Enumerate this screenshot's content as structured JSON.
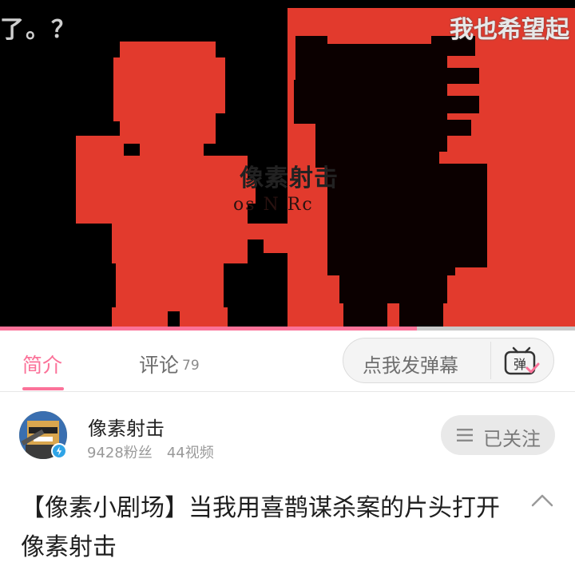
{
  "video": {
    "caption_left": "了。？",
    "caption_right": "我也希望起",
    "title_cn": "像素射击",
    "title_en": "os N Rc",
    "progress": 0.725,
    "colors": {
      "red": "#e23a2d",
      "black": "#000000"
    }
  },
  "tabs": {
    "intro": "简介",
    "comments": "评论",
    "comments_count": "79",
    "accent": "#fb7299"
  },
  "danmaku": {
    "placeholder": "点我发弹幕",
    "button_icon": "danmaku-tv-icon",
    "button_text": "弹"
  },
  "uploader": {
    "name": "像素射击",
    "fans": "9428粉丝",
    "videos": "44视频",
    "follow_label": "已关注",
    "follow_icon": "menu-icon"
  },
  "video_info": {
    "title": "【像素小剧场】当我用喜鹊谋杀案的片头打开像素射击",
    "expand_icon": "chevron-up-icon"
  }
}
